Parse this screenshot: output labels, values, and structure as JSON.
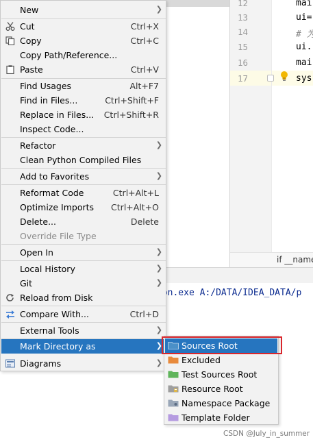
{
  "editor": {
    "line_numbers": [
      "12",
      "13",
      "14",
      "15",
      "16",
      "17"
    ],
    "code_lines": [
      "mai",
      "ui=",
      "# 为",
      "ui.",
      "mai",
      "sys"
    ],
    "breadcrumb": "if __name"
  },
  "console": {
    "text": "hon.exe A:/DATA/IDEA_DATA/p"
  },
  "context_menu": {
    "items": [
      {
        "label": "New",
        "shortcut": "",
        "submenu": true,
        "icon": ""
      },
      {
        "label": "Cut",
        "shortcut": "Ctrl+X",
        "submenu": false,
        "icon": "scissors-icon"
      },
      {
        "label": "Copy",
        "shortcut": "Ctrl+C",
        "submenu": false,
        "icon": "copy-icon"
      },
      {
        "label": "Copy Path/Reference...",
        "shortcut": "",
        "submenu": false,
        "icon": ""
      },
      {
        "label": "Paste",
        "shortcut": "Ctrl+V",
        "submenu": false,
        "icon": "paste-icon"
      },
      {
        "label": "Find Usages",
        "shortcut": "Alt+F7",
        "submenu": false,
        "icon": ""
      },
      {
        "label": "Find in Files...",
        "shortcut": "Ctrl+Shift+F",
        "submenu": false,
        "icon": ""
      },
      {
        "label": "Replace in Files...",
        "shortcut": "Ctrl+Shift+R",
        "submenu": false,
        "icon": ""
      },
      {
        "label": "Inspect Code...",
        "shortcut": "",
        "submenu": false,
        "icon": ""
      },
      {
        "label": "Refactor",
        "shortcut": "",
        "submenu": true,
        "icon": ""
      },
      {
        "label": "Clean Python Compiled Files",
        "shortcut": "",
        "submenu": false,
        "icon": ""
      },
      {
        "label": "Add to Favorites",
        "shortcut": "",
        "submenu": true,
        "icon": ""
      },
      {
        "label": "Reformat Code",
        "shortcut": "Ctrl+Alt+L",
        "submenu": false,
        "icon": ""
      },
      {
        "label": "Optimize Imports",
        "shortcut": "Ctrl+Alt+O",
        "submenu": false,
        "icon": ""
      },
      {
        "label": "Delete...",
        "shortcut": "Delete",
        "submenu": false,
        "icon": ""
      },
      {
        "label": "Override File Type",
        "shortcut": "",
        "submenu": false,
        "icon": "",
        "disabled": true
      },
      {
        "label": "Open In",
        "shortcut": "",
        "submenu": true,
        "icon": ""
      },
      {
        "label": "Local History",
        "shortcut": "",
        "submenu": true,
        "icon": ""
      },
      {
        "label": "Git",
        "shortcut": "",
        "submenu": true,
        "icon": ""
      },
      {
        "label": "Reload from Disk",
        "shortcut": "",
        "submenu": false,
        "icon": "reload-icon"
      },
      {
        "label": "Compare With...",
        "shortcut": "Ctrl+D",
        "submenu": false,
        "icon": "compare-icon"
      },
      {
        "label": "External Tools",
        "shortcut": "",
        "submenu": true,
        "icon": ""
      },
      {
        "label": "Mark Directory as",
        "shortcut": "",
        "submenu": true,
        "icon": "",
        "active": true
      },
      {
        "label": "Diagrams",
        "shortcut": "",
        "submenu": true,
        "icon": "diagram-icon"
      }
    ]
  },
  "mark_submenu": {
    "items": [
      {
        "label": "Sources Root",
        "color": "#4a90c8",
        "icon": "sources-root-folder-icon",
        "active": true
      },
      {
        "label": "Excluded",
        "color": "#e88a3c",
        "icon": "excluded-folder-icon"
      },
      {
        "label": "Test Sources Root",
        "color": "#5fb45b",
        "icon": "test-sources-folder-icon"
      },
      {
        "label": "Resource Root",
        "color": "#8c8c8c",
        "icon": "resource-root-folder-icon"
      },
      {
        "label": "Namespace Package",
        "color": "#9aa7b8",
        "icon": "namespace-package-folder-icon"
      },
      {
        "label": "Template Folder",
        "color": "#b59be0",
        "icon": "template-folder-icon"
      }
    ]
  },
  "watermark": "CSDN @July_in_summer",
  "colors": {
    "menu_bg": "#f2f2f2",
    "selection": "#2675bf",
    "highlight_box": "#d9262c"
  }
}
